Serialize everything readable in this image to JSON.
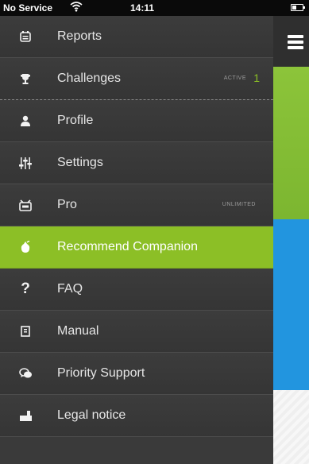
{
  "status_bar": {
    "carrier": "No Service",
    "time": "14:11"
  },
  "menu": {
    "items": [
      {
        "label": "Reports",
        "icon": "calendar-icon"
      },
      {
        "label": "Challenges",
        "icon": "trophy-icon",
        "badge": "ACTIVE",
        "count": "1"
      },
      {
        "label": "Profile",
        "icon": "person-icon"
      },
      {
        "label": "Settings",
        "icon": "sliders-icon"
      },
      {
        "label": "Pro",
        "icon": "pro-icon",
        "badge": "UNLIMITED"
      },
      {
        "label": "Recommend Companion",
        "icon": "recommend-icon",
        "active": true
      },
      {
        "label": "FAQ",
        "icon": "question-icon"
      },
      {
        "label": "Manual",
        "icon": "book-icon"
      },
      {
        "label": "Priority Support",
        "icon": "chat-bubbles-icon"
      },
      {
        "label": "Legal notice",
        "icon": "legal-icon"
      }
    ]
  },
  "colors": {
    "accent": "#8cbf26",
    "menu_bg": "#3a3a3a",
    "blue_panel": "#2295df"
  }
}
